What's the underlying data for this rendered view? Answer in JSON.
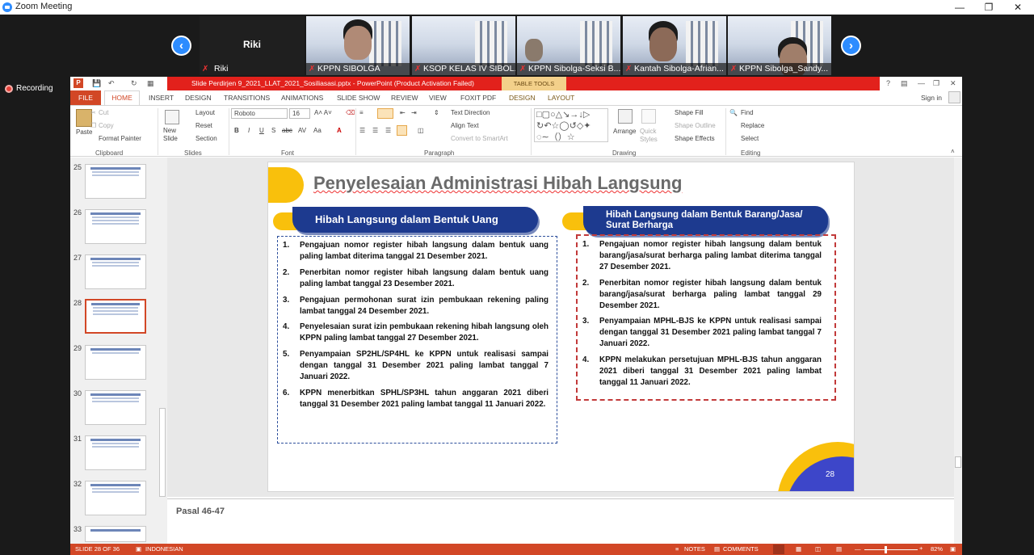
{
  "zoom": {
    "title": "Zoom Meeting",
    "active_speaker": "Riki",
    "self_name": "Riki",
    "recording_label": "Recording",
    "participants": [
      {
        "name": "KPPN SIBOLGA"
      },
      {
        "name": "KSOP KELAS IV SIBOL..."
      },
      {
        "name": "KPPN Sibolga-Seksi B..."
      },
      {
        "name": "Kantah Sibolga-Afrian..."
      },
      {
        "name": "KPPN Sibolga_Sandy..."
      }
    ]
  },
  "ppt": {
    "window_title": "Slide Perdirjen 9_2021_LLAT_2021_Sosiliasasi.pptx - PowerPoint (Product Activation Failed)",
    "table_tools": "TABLE TOOLS",
    "help": "?",
    "sign_in": "Sign in",
    "tabs": [
      "FILE",
      "HOME",
      "INSERT",
      "DESIGN",
      "TRANSITIONS",
      "ANIMATIONS",
      "SLIDE SHOW",
      "REVIEW",
      "VIEW",
      "FOXIT PDF",
      "DESIGN",
      "LAYOUT"
    ],
    "ribbon": {
      "paste": "Paste",
      "cut": "Cut",
      "copy": "Copy",
      "format_painter": "Format Painter",
      "clipboard": "Clipboard",
      "new_slide": "New Slide",
      "layout": "Layout",
      "reset": "Reset",
      "section": "Section",
      "slides": "Slides",
      "font_name": "Roboto",
      "font_size": "16",
      "font": "Font",
      "text_direction": "Text Direction",
      "align_text": "Align Text",
      "convert_smartart": "Convert to SmartArt",
      "paragraph": "Paragraph",
      "arrange": "Arrange",
      "quick_styles": "Quick Styles",
      "shape_fill": "Shape Fill",
      "shape_outline": "Shape Outline",
      "shape_effects": "Shape Effects",
      "drawing": "Drawing",
      "find": "Find",
      "replace": "Replace",
      "select": "Select",
      "editing": "Editing"
    },
    "thumbnails": [
      "25",
      "26",
      "27",
      "28",
      "29",
      "30",
      "31",
      "32",
      "33"
    ],
    "selected_slide": "28",
    "notes": "Pasal 46-47",
    "status": {
      "slide_info": "SLIDE 28 OF 36",
      "language": "INDONESIAN",
      "notes": "NOTES",
      "comments": "COMMENTS",
      "zoom": "82%"
    }
  },
  "slide": {
    "title": "Penyelesaian Administrasi Hibah Langsung",
    "page_number": "28",
    "left_heading": "Hibah Langsung dalam Bentuk Uang",
    "right_heading": "Hibah Langsung dalam Bentuk Barang/Jasa/ Surat Berharga",
    "left_items": [
      {
        "num": "1.",
        "text": "Pengajuan nomor register hibah langsung dalam bentuk uang paling lambat diterima tanggal 21 Desember 2021."
      },
      {
        "num": "2.",
        "text": "Penerbitan nomor register hibah langsung dalam bentuk uang paling lambat tanggal 23 Desember 2021."
      },
      {
        "num": "3.",
        "text": "Pengajuan permohonan surat izin pembukaan rekening paling lambat tanggal 24 Desember 2021."
      },
      {
        "num": "4.",
        "text": "Penyelesaian surat izin pembukaan rekening hibah langsung oleh KPPN paling lambat tanggal 27 Desember 2021."
      },
      {
        "num": "5.",
        "text": "Penyampaian SP2HL/SP4HL ke KPPN untuk realisasi sampai dengan tanggal 31 Desember 2021 paling lambat tanggal 7 Januari 2022."
      },
      {
        "num": "6.",
        "text": "KPPN menerbitkan SPHL/SP3HL tahun anggaran 2021 diberi tanggal 31 Desember 2021 paling lambat tanggal 11 Januari 2022."
      }
    ],
    "right_items": [
      {
        "num": "1.",
        "text": "Pengajuan nomor register hibah langsung dalam bentuk barang/jasa/surat berharga paling lambat diterima tanggal 27 Desember 2021."
      },
      {
        "num": "2.",
        "text": "Penerbitan nomor register hibah langsung dalam bentuk barang/jasa/surat berharga paling lambat tanggal 29 Desember 2021."
      },
      {
        "num": "3.",
        "text": "Penyampaian MPHL-BJS ke KPPN untuk realisasi sampai dengan tanggal 31 Desember 2021 paling lambat tanggal 7 Januari 2022."
      },
      {
        "num": "4.",
        "text": "KPPN melakukan persetujuan MPHL-BJS tahun anggaran 2021 diberi tanggal 31 Desember 2021 paling lambat tanggal 11 Januari 2022."
      }
    ]
  }
}
